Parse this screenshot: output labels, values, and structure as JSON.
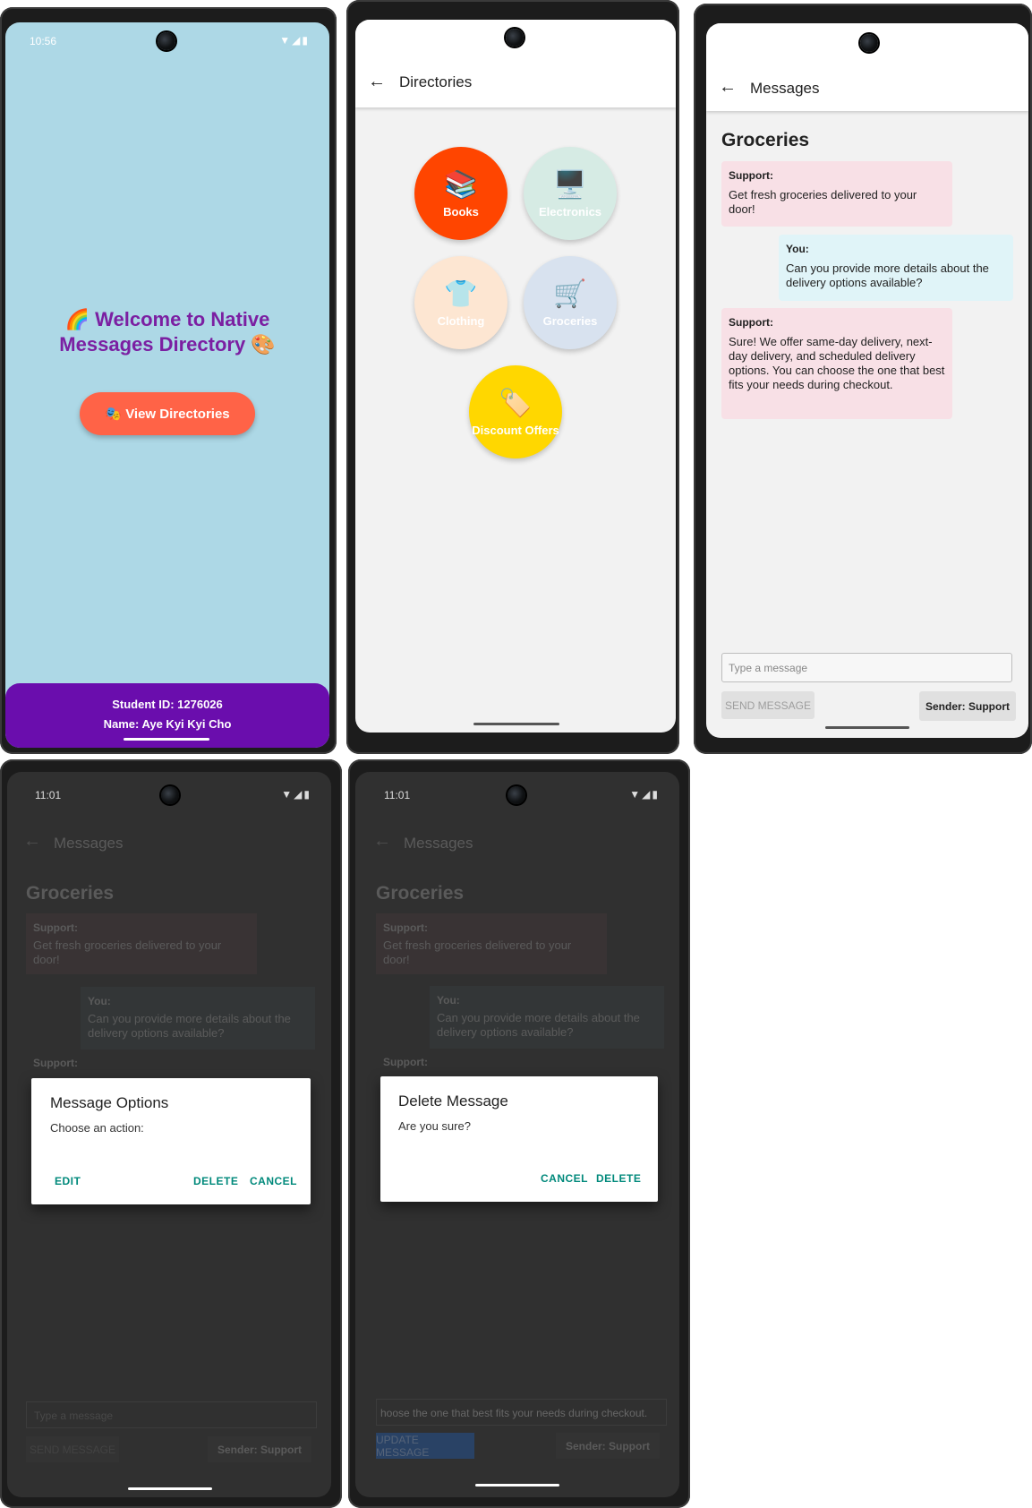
{
  "screen1": {
    "status_time": "10:56",
    "welcome_line1": "🌈 Welcome to Native",
    "welcome_line2": "Messages Directory 🎨",
    "button_label": "🎭 View Directories",
    "student_id": "Student ID: 1276026",
    "name": "Name: Aye Kyi Kyi Cho"
  },
  "screen2": {
    "title": "Directories",
    "directories": [
      {
        "label": "Books",
        "emoji": "📚",
        "color": "#ff4500"
      },
      {
        "label": "Electronics",
        "emoji": "🖥️",
        "color": "#d6ebe4"
      },
      {
        "label": "Clothing",
        "emoji": "👕",
        "color": "#fde6d2"
      },
      {
        "label": "Groceries",
        "emoji": "🛒",
        "color": "#d8e2ef"
      },
      {
        "label": "Discount Offers",
        "emoji": "🏷️",
        "color": "#ffd700"
      }
    ]
  },
  "messages": {
    "appbar_title": "Messages",
    "directory_title": "Groceries",
    "items": [
      {
        "sender": "Support:",
        "text": "Get fresh groceries delivered to your door!"
      },
      {
        "sender": "You:",
        "text": "Can you provide more details about the delivery options available?"
      },
      {
        "sender": "Support:",
        "text": "Sure! We offer same-day delivery, next-day delivery, and scheduled delivery options. You can choose the one that best fits your needs during checkout."
      }
    ],
    "input_placeholder": "Type a message",
    "send_label": "SEND MESSAGE",
    "update_label": "UPDATE MESSAGE",
    "sender_label": "Sender: Support",
    "edit_text_value": "hoose the one that best fits your needs during checkout."
  },
  "screen4": {
    "status_time": "11:01",
    "dialog_title": "Message Options",
    "dialog_message": "Choose an action:",
    "edit": "EDIT",
    "delete": "DELETE",
    "cancel": "CANCEL"
  },
  "screen5": {
    "status_time": "11:01",
    "dialog_title": "Delete Message",
    "dialog_message": "Are you sure?",
    "cancel": "CANCEL",
    "delete": "DELETE"
  },
  "status_icons": "▼◢▮",
  "colors": {
    "accent_purple": "#7b1fa2",
    "button_tomato": "#ff6347",
    "footer_purple": "#6a0dad",
    "dialog_action_teal": "#00897b"
  }
}
